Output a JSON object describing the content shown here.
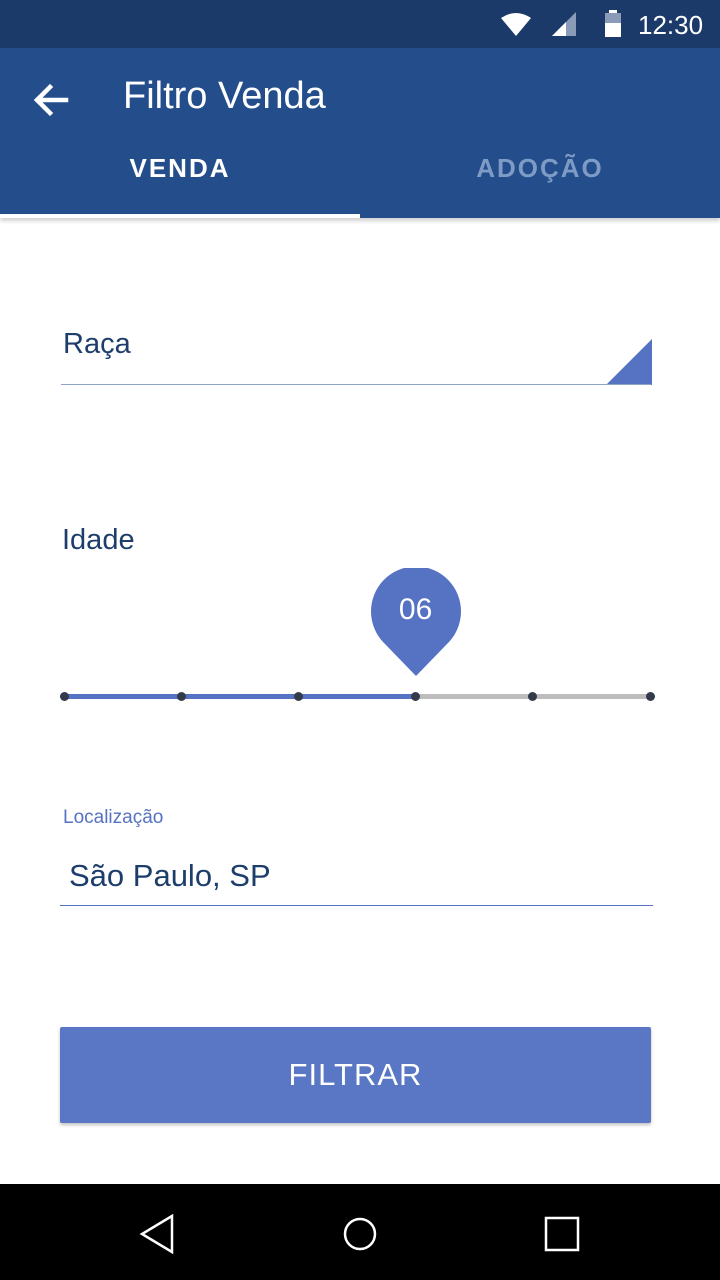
{
  "status_bar": {
    "time": "12:30",
    "icons": [
      "wifi-icon",
      "cell-signal-icon",
      "battery-icon"
    ]
  },
  "app_bar": {
    "title": "Filtro Venda",
    "back_icon": "arrow-left-icon"
  },
  "tabs": [
    {
      "label": "VENDA",
      "selected": true
    },
    {
      "label": "ADOÇÃO",
      "selected": false
    }
  ],
  "form": {
    "raca": {
      "label": "Raça",
      "icon": "dropdown-triangle-icon"
    },
    "idade": {
      "label": "Idade",
      "value_label": "06",
      "slider_position": 0.6,
      "ticks": 6
    },
    "localizacao": {
      "label": "Localização",
      "value": "São Paulo, SP"
    },
    "submit_label": "FILTRAR"
  },
  "nav_bar": {
    "buttons": [
      "back-triangle-icon",
      "home-circle-icon",
      "recents-square-icon"
    ]
  },
  "colors": {
    "status_bar": "#1b3a6a",
    "app_bar": "#234e8b",
    "accent": "#5672c2",
    "button": "#5a77c5",
    "text_dark": "#1d3d6b",
    "tab_inactive": "#7e9bc6"
  }
}
